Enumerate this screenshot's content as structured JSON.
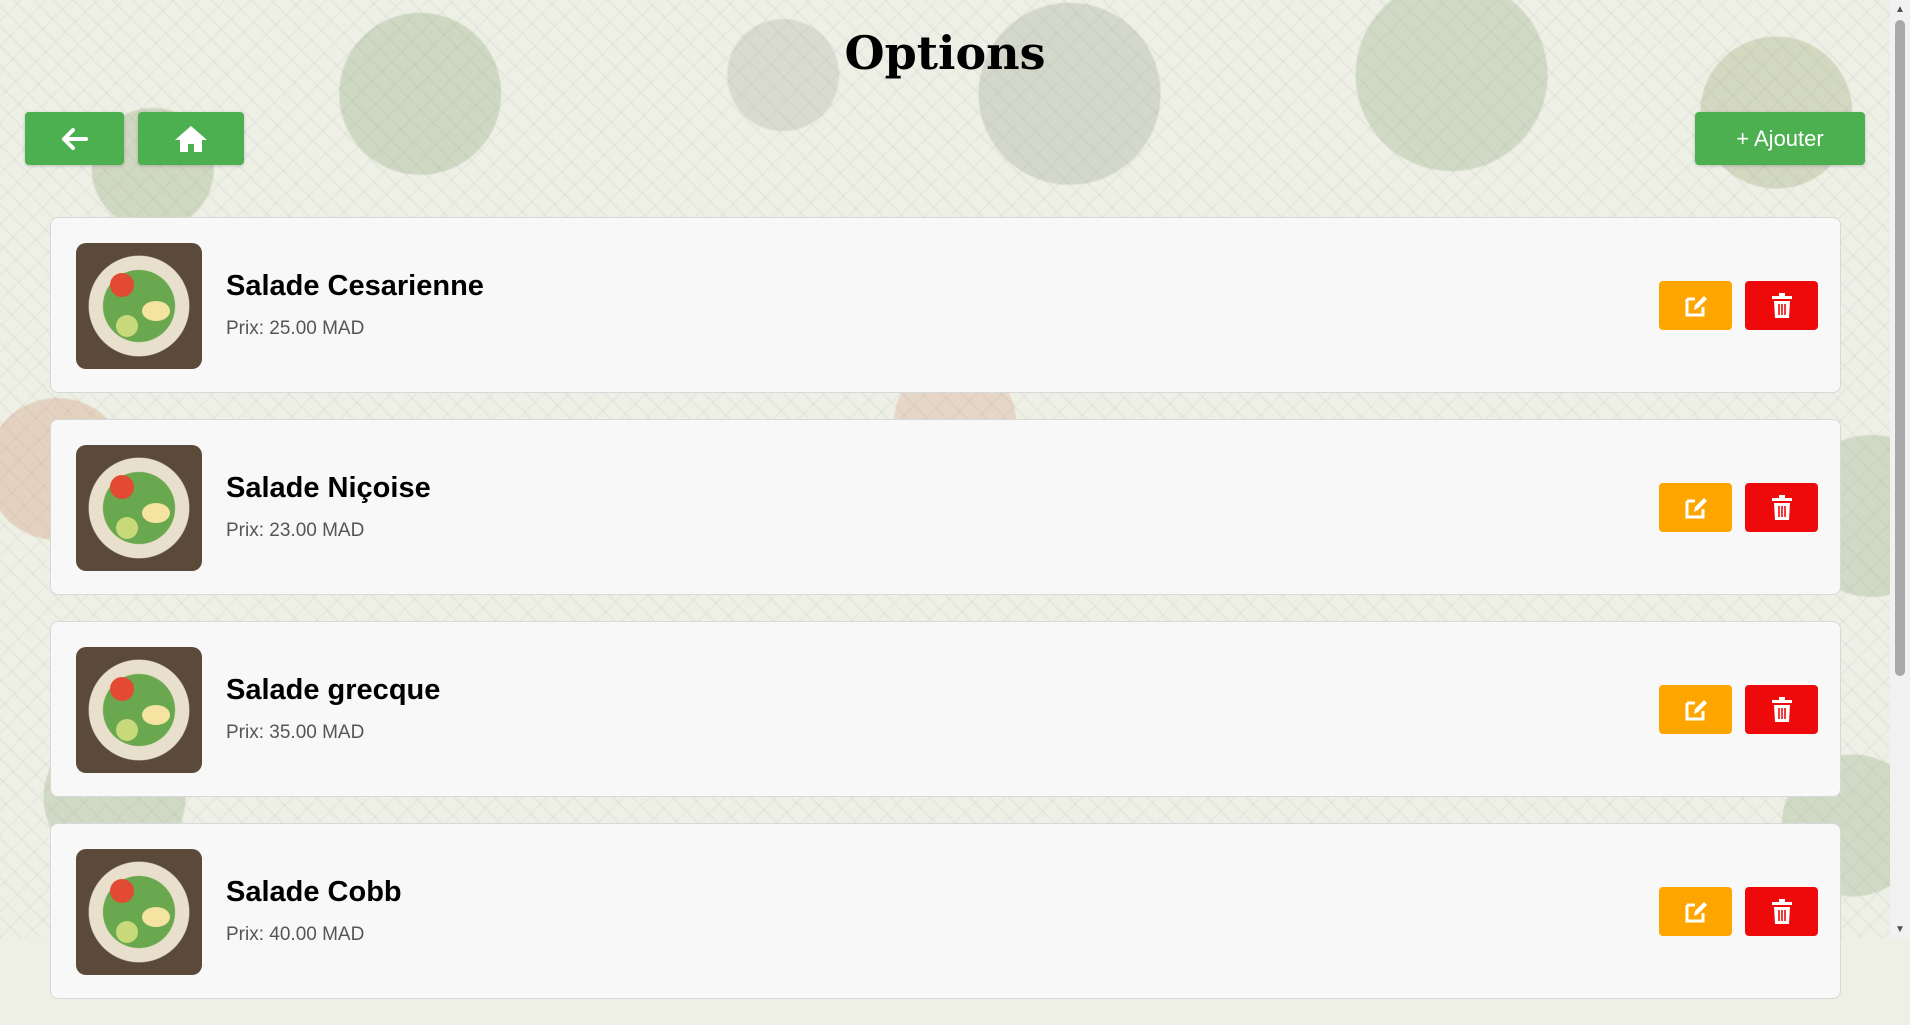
{
  "page": {
    "title": "Options"
  },
  "toolbar": {
    "back_icon": "arrow-left-icon",
    "home_icon": "home-icon",
    "add_label": "+ Ajouter"
  },
  "items": [
    {
      "name": "Salade Cesarienne",
      "price": "Prix: 25.00 MAD"
    },
    {
      "name": "Salade Niçoise",
      "price": "Prix: 23.00 MAD"
    },
    {
      "name": "Salade grecque",
      "price": "Prix: 35.00 MAD"
    },
    {
      "name": "Salade Cobb",
      "price": "Prix: 40.00 MAD"
    }
  ],
  "actions": {
    "edit_icon": "edit-icon",
    "delete_icon": "trash-icon"
  },
  "colors": {
    "primary": "#4caf50",
    "edit": "#ffa500",
    "delete": "#ee0a0a"
  }
}
